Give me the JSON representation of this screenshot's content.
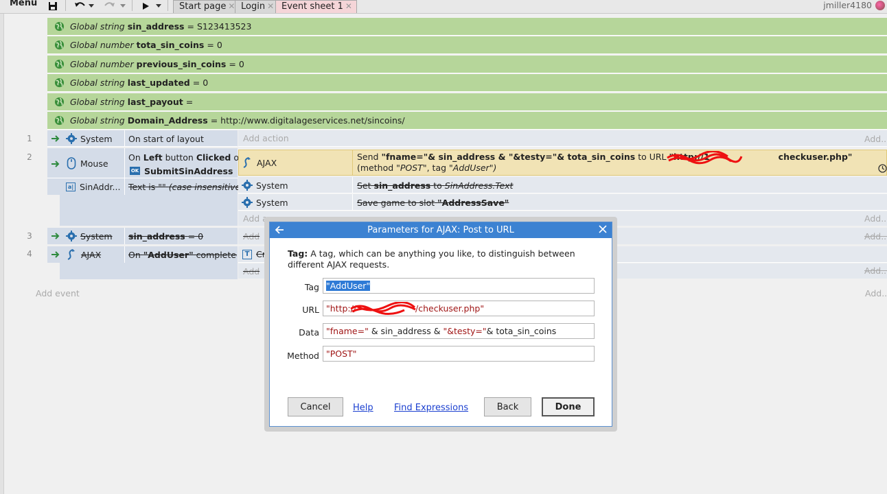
{
  "toolbar": {
    "menu_label": "Menu",
    "tabs": [
      {
        "label": "Start page"
      },
      {
        "label": "Login"
      },
      {
        "label": "Event sheet 1"
      }
    ],
    "username": "jmiller4180"
  },
  "globals": [
    {
      "kind": "Global string",
      "name": "sin_address",
      "value": "S123413523"
    },
    {
      "kind": "Global number",
      "name": "tota_sin_coins",
      "value": "0"
    },
    {
      "kind": "Global number",
      "name": "previous_sin_coins",
      "value": "0"
    },
    {
      "kind": "Global string",
      "name": "last_updated",
      "value": "0"
    },
    {
      "kind": "Global string",
      "name": "last_payout",
      "value": ""
    },
    {
      "kind": "Global string",
      "name": "Domain_Address",
      "value": "http://www.digitalageservices.net/sincoins/"
    }
  ],
  "events": {
    "e1": {
      "num": "1",
      "object": "System",
      "condition": "On start of layout",
      "add_action": "Add action",
      "add_short": "Add..."
    },
    "e2": {
      "num": "2",
      "object": "Mouse",
      "cond_on": "On",
      "cond_left": "Left",
      "cond_button": "button",
      "cond_clicked": "Clicked",
      "cond_on2": "on",
      "cond_target": "SubmitSinAddress",
      "sub_object": "SinAddr...",
      "sub_condition": "Text is \"\"",
      "sub_condition_note": "(case insensitive)",
      "actions": [
        {
          "object": "AJAX",
          "t1": "Send",
          "t2": "\"fname=\"& sin_address & \"&testy=\"& tota_sin_coins",
          "t3": "to URL",
          "t4": "\"http://1",
          "t5": "checkuser.php\"",
          "t6": "(method",
          "t7": "\"POST\"",
          "t8": ", tag",
          "t9": "\"AddUser\")"
        },
        {
          "object": "System",
          "t1": "Set",
          "t2": "sin_address",
          "t3": "to",
          "t4": "SinAddress.Text"
        },
        {
          "object": "System",
          "t1": "Save game to slot",
          "t2": "\"AddressSave\""
        }
      ],
      "add_action": "Add a",
      "add_short": "Add..."
    },
    "e3": {
      "num": "3",
      "object": "System",
      "cond_name": "sin_address",
      "cond_rest": "= 0",
      "add_action": "Add",
      "add_short": "Add..."
    },
    "e4": {
      "num": "4",
      "object": "AJAX",
      "cond_on": "On",
      "cond_tag": "\"AddUser\"",
      "cond_rest": "completed",
      "action_obj": "Cr",
      "add_action": "Add",
      "add_short": "Add..."
    },
    "add_event": "Add event",
    "add_short": "Add..."
  },
  "dialog": {
    "title": "Parameters for AJAX: Post to URL",
    "desc_bold": "Tag:",
    "desc_text": "A tag, which can be anything you like, to distinguish between different AJAX requests.",
    "params": [
      {
        "label": "Tag",
        "value": "\"AddUser\""
      },
      {
        "label": "URL",
        "value_start": "\"http://",
        "value_end": "/checkuser.php\""
      },
      {
        "label": "Data",
        "s1": "\"fname=\"",
        "s2": "& sin_address &",
        "s3": "\"&testy=\"",
        "s4": "& tota_sin_coins"
      },
      {
        "label": "Method",
        "value": "\"POST\""
      }
    ],
    "buttons": {
      "cancel": "Cancel",
      "help": "Help",
      "find": "Find Expressions",
      "back": "Back",
      "done": "Done"
    }
  },
  "colors": {
    "global_bg": "#b6d69a",
    "event_bg": "#d0dbe8",
    "selected_action_bg": "#f1e3b5",
    "dialog_title": "#3c82d2",
    "string_red": "#a01616",
    "link_blue": "#1a3fd0",
    "accent_green": "#2e8a3e"
  }
}
